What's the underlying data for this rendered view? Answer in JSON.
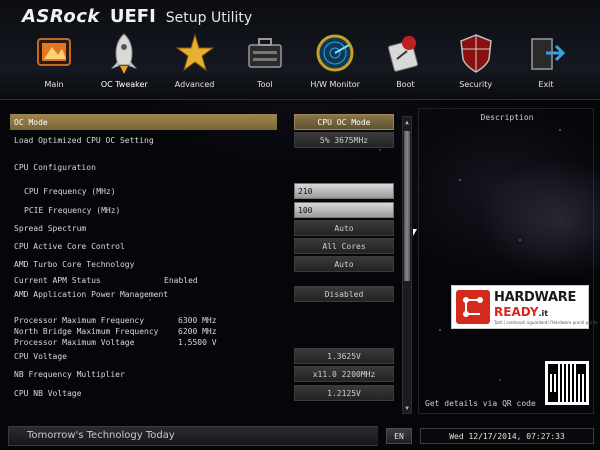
{
  "header": {
    "brand": "ASRock",
    "product": "UEFI",
    "subtitle": "Setup Utility"
  },
  "nav": {
    "items": [
      {
        "label": "Main",
        "icon": "main-icon",
        "active": false
      },
      {
        "label": "OC Tweaker",
        "icon": "rocket-icon",
        "active": true
      },
      {
        "label": "Advanced",
        "icon": "star-icon",
        "active": false
      },
      {
        "label": "Tool",
        "icon": "toolbox-icon",
        "active": false
      },
      {
        "label": "H/W Monitor",
        "icon": "radar-icon",
        "active": false
      },
      {
        "label": "Boot",
        "icon": "boot-icon",
        "active": false
      },
      {
        "label": "Security",
        "icon": "shield-icon",
        "active": false
      },
      {
        "label": "Exit",
        "icon": "exit-icon",
        "active": false
      }
    ]
  },
  "settings": {
    "oc_mode": {
      "label": "OC Mode",
      "value": "CPU OC Mode"
    },
    "load_oc": {
      "label": "Load Optimized CPU OC Setting",
      "value": "5%  3675MHz"
    },
    "cpu_config": {
      "label": "CPU Configuration"
    },
    "cpu_freq": {
      "label": "CPU Frequency (MHz)",
      "value": "210"
    },
    "pcie_freq": {
      "label": "PCIE Frequency (MHz)",
      "value": "100"
    },
    "spread": {
      "label": "Spread Spectrum",
      "value": "Auto"
    },
    "core_ctrl": {
      "label": "CPU Active Core Control",
      "value": "All Cores"
    },
    "turbo": {
      "label": "AMD Turbo Core Technology",
      "value": "Auto"
    },
    "apm_status": {
      "label": "Current APM Status",
      "value": "Enabled"
    },
    "apm": {
      "label": "AMD Application Power Management",
      "value": "Disabled"
    },
    "proc_max_freq": {
      "label": "Processor Maximum Frequency",
      "value": "6300 MHz"
    },
    "nb_max_freq": {
      "label": "North Bridge Maximum Frequency",
      "value": "6200 MHz"
    },
    "proc_max_volt": {
      "label": "Processor Maximum Voltage",
      "value": "1.5500 V"
    },
    "cpu_volt": {
      "label": "CPU Voltage",
      "value": "1.3625V"
    },
    "nb_mult": {
      "label": "NB Frequency Multiplier",
      "value": "x11.0 2200MHz"
    },
    "cpu_nb_volt": {
      "label": "CPU NB Voltage",
      "value": "1.2125V"
    }
  },
  "description": {
    "title": "Description",
    "qr_text": "Get details via QR code",
    "watermark": {
      "line1": "HARDWARE",
      "line2": "READY",
      "suffix": ".it",
      "tagline": "Tutti i contenuti riguardanti l'Hardware pronti per te"
    }
  },
  "footer": {
    "tagline": "Tomorrow's Technology Today",
    "language": "EN",
    "datetime": "Wed 12/17/2014, 07:27:33"
  },
  "colors": {
    "highlight": "#9e8650",
    "background": "#05060a"
  }
}
